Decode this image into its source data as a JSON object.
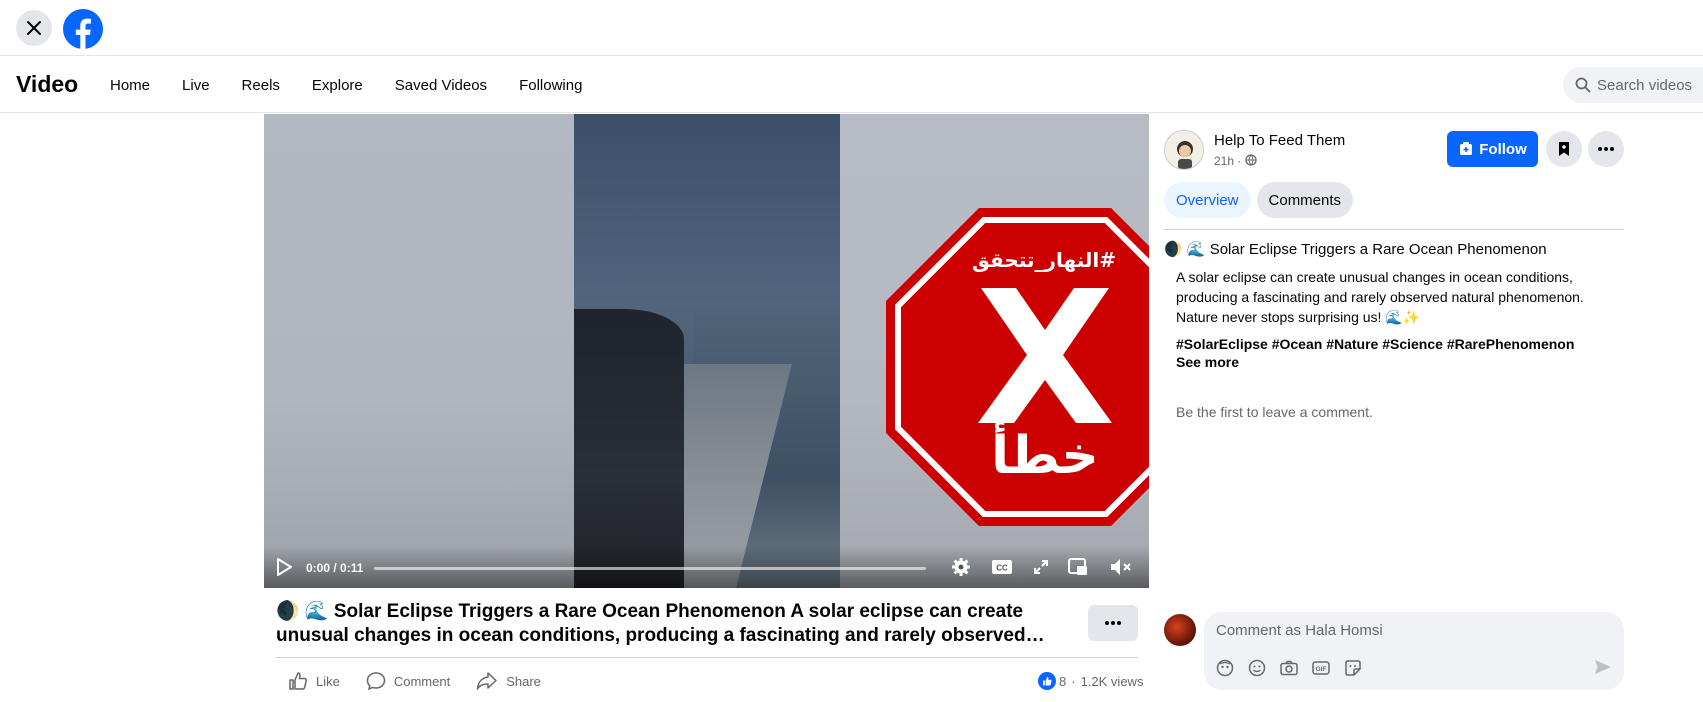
{
  "topbar": {
    "close_icon": "close-icon",
    "logo_icon": "facebook-logo-icon"
  },
  "nav": {
    "title": "Video",
    "items": [
      "Home",
      "Live",
      "Reels",
      "Explore",
      "Saved Videos",
      "Following"
    ],
    "search_placeholder": "Search videos"
  },
  "video": {
    "overlay_top_text": "#النهار_تتحقق",
    "overlay_bottom_text": "خطأ",
    "time": "0:00 / 0:11",
    "progress": 0,
    "controls": [
      "play-icon",
      "settings-icon",
      "captions-icon",
      "fullscreen-icon",
      "pip-icon",
      "mute-icon"
    ],
    "caption": "🌒 🌊 Solar Eclipse Triggers a Rare Ocean Phenomenon A solar eclipse can create unusual changes in ocean conditions, producing a fascinating and rarely observed…",
    "actions": [
      "Like",
      "Comment",
      "Share"
    ],
    "reactions_count": "8",
    "views": "1.2K views",
    "colors": {
      "stop_red": "#cc0000",
      "accent": "#0866ff"
    }
  },
  "panel": {
    "page_name": "Help To Feed Them",
    "post_time": "21h ·",
    "follow_label": "Follow",
    "tabs": [
      "Overview",
      "Comments"
    ],
    "post_title": "🌒 🌊 Solar Eclipse Triggers a Rare Ocean Phenomenon",
    "post_body": "A solar eclipse can create unusual changes in ocean conditions, producing a fascinating and rarely observed natural phenomenon. Nature never stops surprising us! 🌊✨",
    "hashtags": "#SolarEclipse #Ocean #Nature #Science #RarePhenomenon",
    "see_more": "See more",
    "first_comment": "Be the first to leave a comment.",
    "composer_placeholder": "Comment as Hala Homsi"
  }
}
